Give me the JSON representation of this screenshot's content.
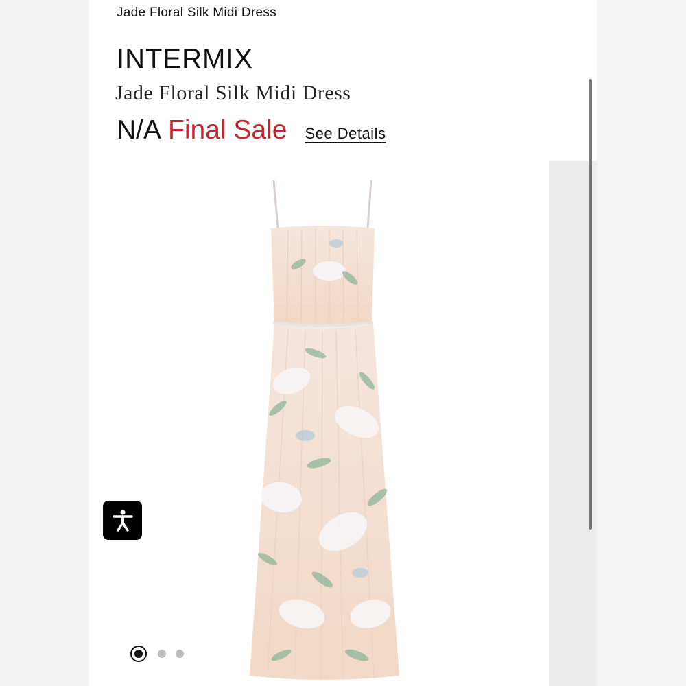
{
  "header": {
    "top_title": "Jade Floral Silk Midi Dress"
  },
  "product": {
    "brand": "INTERMIX",
    "name": "Jade Floral Silk Midi Dress",
    "price": "N/A",
    "sale_label": "Final Sale",
    "see_details": "See Details",
    "image_alt": "Jade Floral Silk Midi Dress product photo"
  },
  "carousel": {
    "total_slides": 3,
    "active_index": 0
  },
  "colors": {
    "sale_red": "#c1272d",
    "dress_base": "#f6dcc7",
    "leaf_green": "#8fb59a",
    "flower_white": "#f7f3f4"
  },
  "icons": {
    "accessibility": "accessibility-icon"
  }
}
